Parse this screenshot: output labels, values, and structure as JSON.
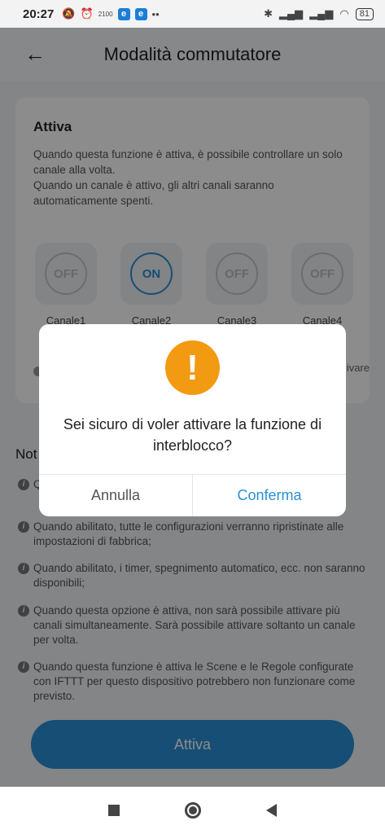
{
  "status_bar": {
    "time": "20:27",
    "icons_left": [
      "mute-icon",
      "alarm-icon",
      "data-icon",
      "app-e-icon",
      "app-e-icon",
      "more-dots"
    ],
    "e_label": "e",
    "data_label": "2100",
    "battery": "81"
  },
  "header": {
    "title": "Modalità commutatore",
    "back_icon": "←"
  },
  "card": {
    "heading": "Attiva",
    "desc1": "Quando questa funzione è attiva, è possibile controllare un solo canale alla volta.",
    "desc2": "Quando un canale è attivo, gli altri canali saranno automaticamente spenti.",
    "channels": [
      {
        "label": "Canale1",
        "state": "OFF"
      },
      {
        "label": "Canale2",
        "state": "ON"
      },
      {
        "label": "Canale3",
        "state": "OFF"
      },
      {
        "label": "Canale4",
        "state": "OFF"
      }
    ],
    "note_tail": "ivare"
  },
  "notes": {
    "title": "Not",
    "items": [
      "Q",
      "Quando abilitato, tutte le configurazioni verranno ripristinate alle impostazioni di fabbrica;",
      "Quando abilitato, i timer, spegnimento automatico, ecc. non saranno disponibili;",
      "Quando questa opzione è attiva, non sarà possibile attivare più canali simultaneamente. Sarà possibile attivare soltanto un canale per volta.",
      "Quando questa funzione è attiva le Scene e le Regole configurate con IFTTT per questo dispositivo potrebbero non funzionare come previsto."
    ],
    "icon_glyph": "i"
  },
  "activate_button": "Attiva",
  "dialog": {
    "icon_glyph": "!",
    "message": "Sei sicuro di voler attivare la funzione di interblocco?",
    "cancel": "Annulla",
    "confirm": "Conferma"
  },
  "colors": {
    "accent": "#2a8fd6",
    "warning": "#f29a12"
  }
}
